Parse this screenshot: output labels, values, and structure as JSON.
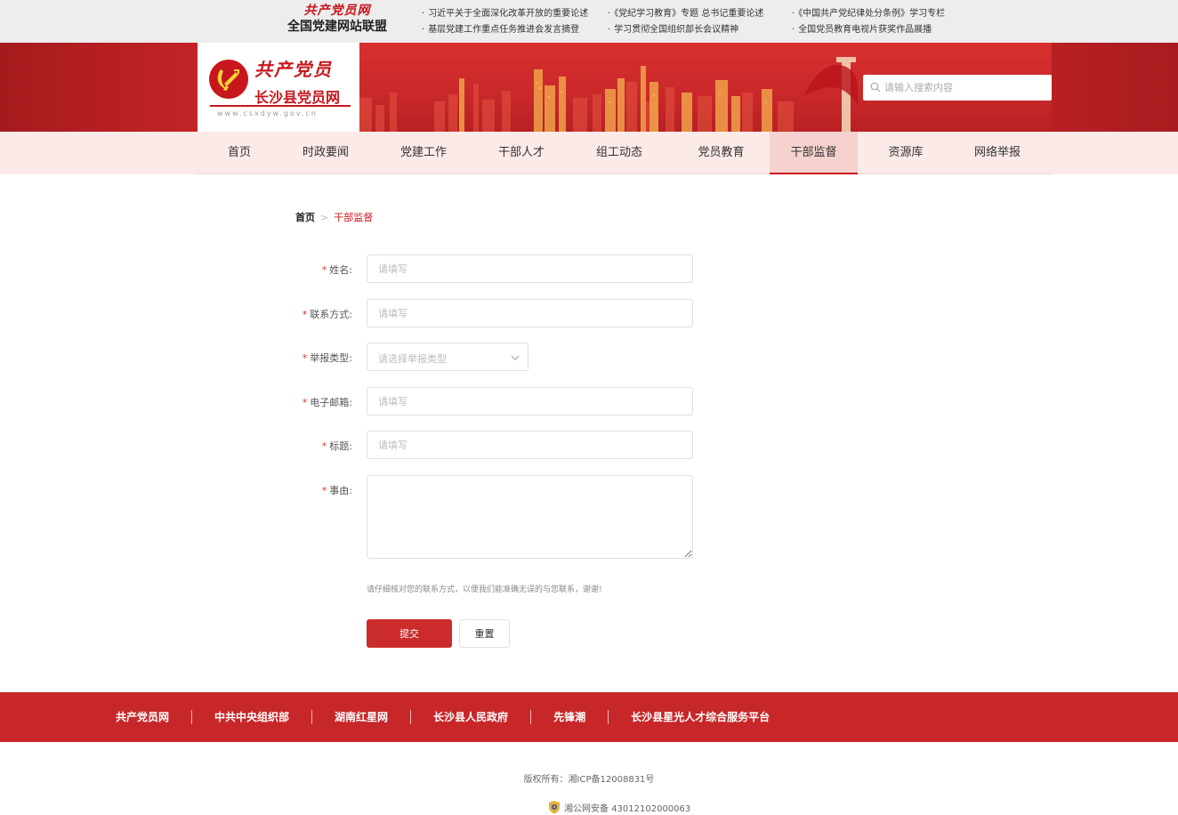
{
  "top_bar": {
    "alliance_script": "共产党员网",
    "alliance_name": "全国党建网站联盟",
    "links": [
      "习近平关于全面深化改革开放的重要论述",
      "《党纪学习教育》专题  总书记重要论述",
      "《中国共产党纪律处分条例》学习专栏",
      "基层党建工作重点任务推进会发言摘登",
      "学习贯彻全国组织部长会议精神",
      "全国党员教育电视片获奖作品展播"
    ]
  },
  "header": {
    "logo_script": "共产党员",
    "logo_name": "长沙县党员网",
    "logo_url": "www.csxdyw.gov.cn",
    "search_placeholder": "请输入搜索内容",
    "search_icon": "search-icon"
  },
  "nav": {
    "items": [
      {
        "label": "首页",
        "active": false
      },
      {
        "label": "时政要闻",
        "active": false
      },
      {
        "label": "党建工作",
        "active": false
      },
      {
        "label": "干部人才",
        "active": false
      },
      {
        "label": "组工动态",
        "active": false
      },
      {
        "label": "党员教育",
        "active": false
      },
      {
        "label": "干部监督",
        "active": true
      },
      {
        "label": "资源库",
        "active": false
      },
      {
        "label": "网络举报",
        "active": false
      }
    ]
  },
  "breadcrumb": {
    "home": "首页",
    "separator": ">",
    "current": "干部监督"
  },
  "form": {
    "required_mark": "*",
    "name_label": "姓名:",
    "name_placeholder": "请填写",
    "contact_label": "联系方式:",
    "contact_placeholder": "请填写",
    "type_label": "举报类型:",
    "type_placeholder": "请选择举报类型",
    "email_label": "电子邮箱:",
    "email_placeholder": "请填写",
    "title_label": "标题:",
    "title_placeholder": "请填写",
    "reason_label": "事由:",
    "hint": "请仔细核对您的联系方式，以便我们能准确无误的与您联系，谢谢!",
    "submit_label": "提交",
    "reset_label": "重置"
  },
  "footer": {
    "links": [
      "共产党员网",
      "中共中央组织部",
      "湖南红星网",
      "长沙县人民政府",
      "先锋潮",
      "长沙县星光人才综合服务平台"
    ],
    "copyright": "版权所有：湘ICP备12008831号",
    "beian": "湘公网安备 43012102000063"
  },
  "colors": {
    "brand_red": "#c8161d",
    "nav_bg": "#fbeae8",
    "footer_red": "#c8272a",
    "submit_red": "#cb2b2b"
  }
}
